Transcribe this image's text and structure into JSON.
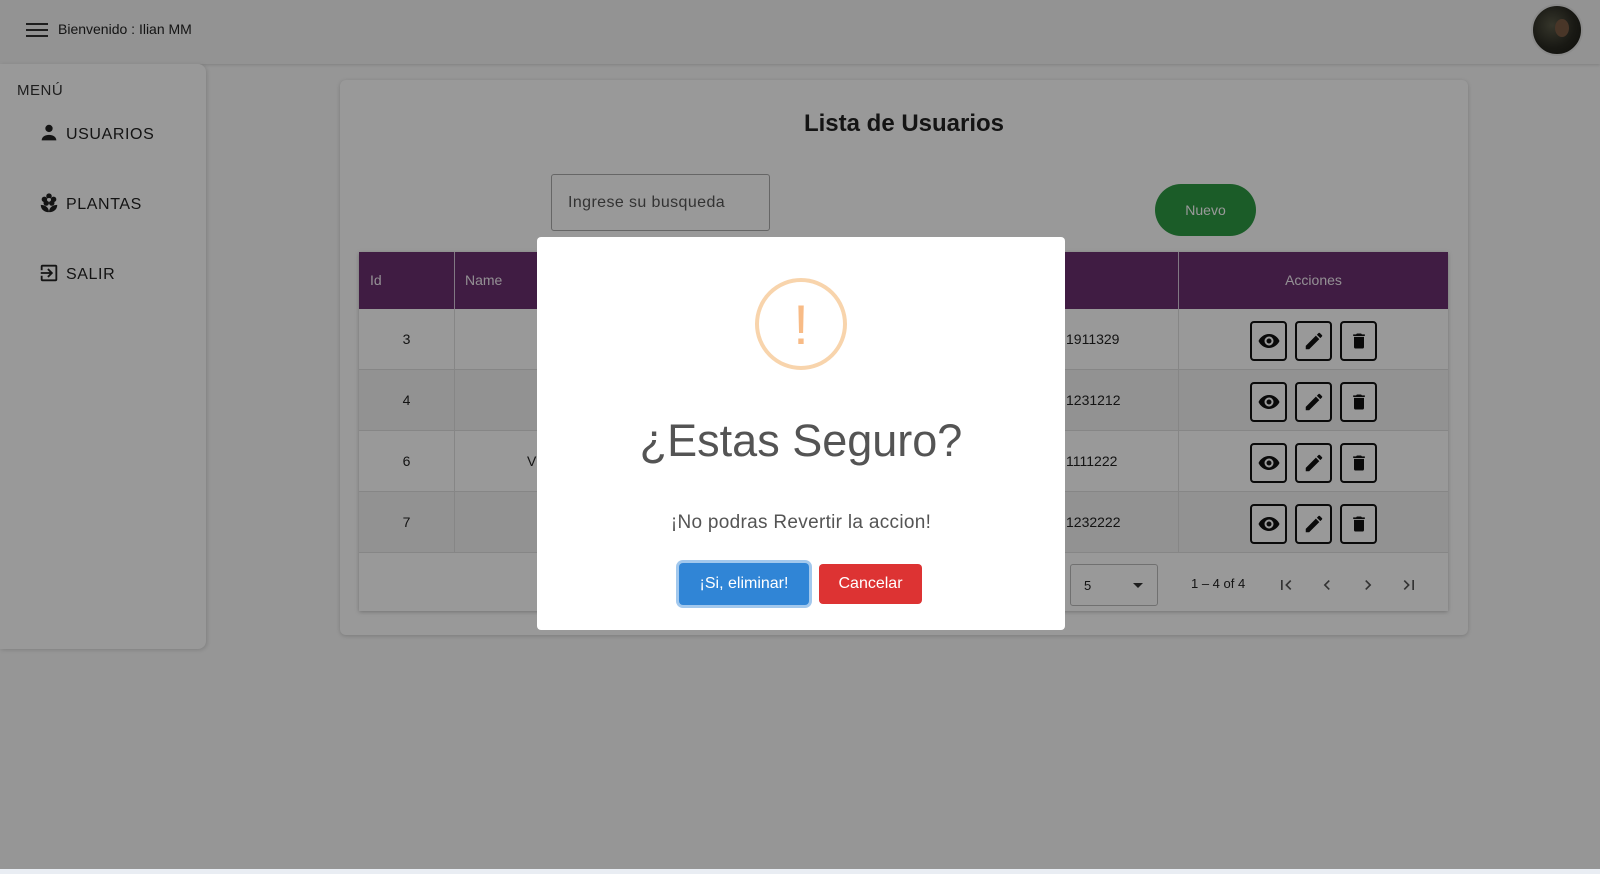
{
  "header": {
    "welcome": "Bienvenido : Ilian MM",
    "menu_icon": "hamburger-menu-icon",
    "avatar": "user-avatar"
  },
  "sidebar": {
    "title": "MENÚ",
    "items": [
      {
        "label": "USUARIOS",
        "icon": "person-icon"
      },
      {
        "label": "PLANTAS",
        "icon": "flower-icon"
      },
      {
        "label": "SALIR",
        "icon": "logout-icon"
      }
    ]
  },
  "main": {
    "title": "Lista de Usuarios",
    "search_placeholder": "Ingrese su busqueda",
    "new_button": "Nuevo",
    "accent_color": "#6b3070",
    "table": {
      "columns": [
        "Id",
        "Name",
        "Acciones"
      ],
      "rows": [
        {
          "id": "3",
          "name": "",
          "phone": "1911329"
        },
        {
          "id": "4",
          "name": "",
          "phone": "1231212"
        },
        {
          "id": "6",
          "name": "V",
          "phone": "1111222"
        },
        {
          "id": "7",
          "name": "",
          "phone": "1232222"
        }
      ],
      "action_icons": [
        "eye-icon",
        "pencil-icon",
        "trash-icon"
      ]
    },
    "paginator": {
      "page_size": "5",
      "range": "1 – 4 of 4"
    }
  },
  "dialog": {
    "icon": "warning-icon",
    "icon_color": "#f8bb86",
    "title": "¿Estas Seguro?",
    "text": "¡No podras Revertir la accion!",
    "confirm_label": "¡Si, eliminar!",
    "cancel_label": "Cancelar",
    "confirm_color": "#3085d6",
    "cancel_color": "#dd3333"
  }
}
